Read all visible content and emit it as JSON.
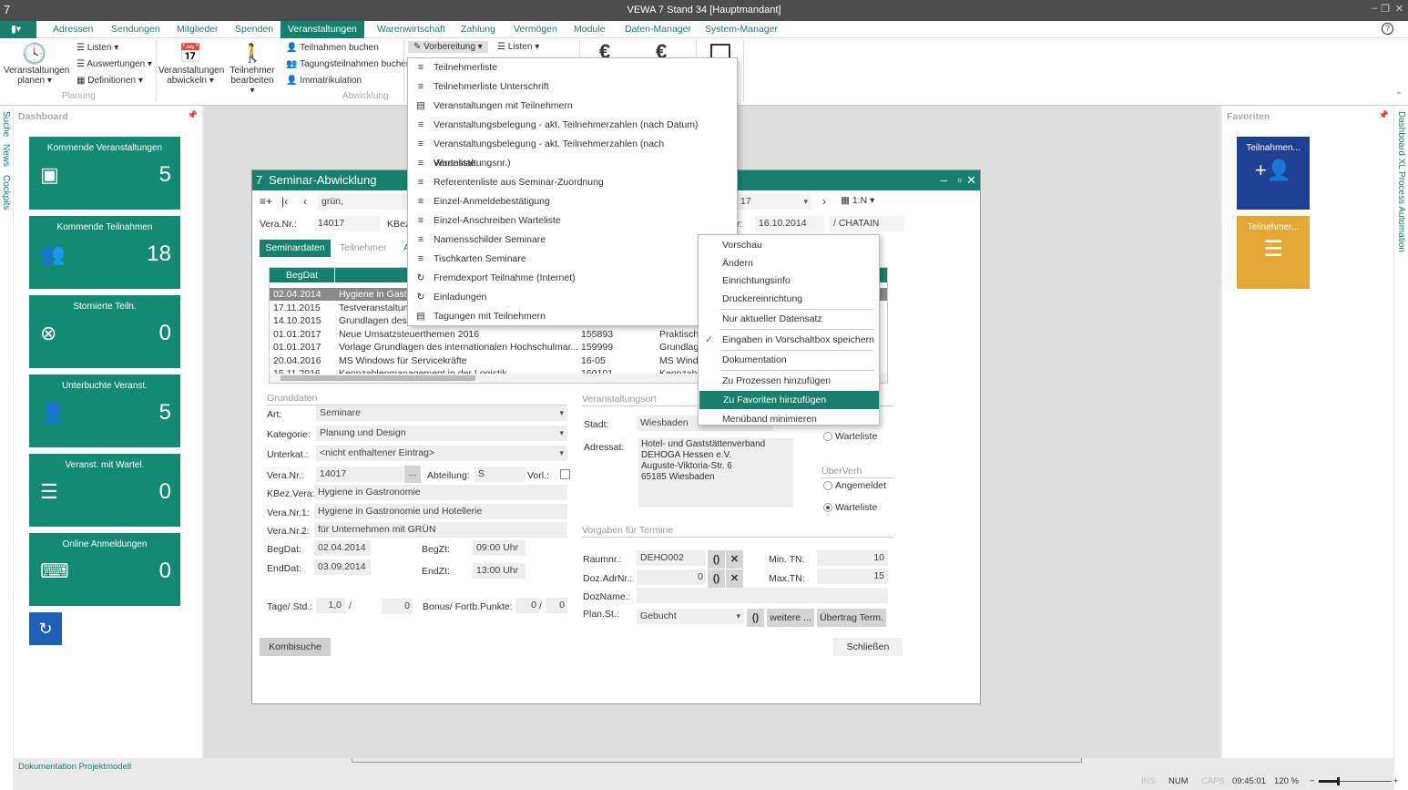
{
  "window": {
    "title": "VEWA 7 Stand 34 [Hauptmandant]",
    "logo": "7"
  },
  "menu": {
    "tabs": [
      "Adressen",
      "Sendungen",
      "Mitglieder",
      "Spenden",
      "Veranstaltungen",
      "Warenwirtschaft",
      "Zahlung",
      "Vermögen",
      "Module",
      "Daten-Manager",
      "System-Manager"
    ],
    "active": "Veranstaltungen"
  },
  "ribbon": {
    "planen": "Veranstaltungen planen ▾",
    "listen": "Listen ▾",
    "auswertungen": "Auswertungen ▾",
    "definitionen": "Definitionen ▾",
    "group_planung": "Planung",
    "abwickeln": "Veranstaltungen abwickeln ▾",
    "bearbeiten": "Teilnehmer bearbeiten ▾",
    "teilnahmen_buchen": "Teilnahmen buchen",
    "tagung_buchen": "Tagungsteilnahmen buchen",
    "immatrikulation": "Immatrikulation",
    "group_abwicklung": "Abwicklung",
    "vorbereitung": "Vorbereitung ▾",
    "listen2": "Listen ▾",
    "euro": "€"
  },
  "dashboard": {
    "title": "Dashboard",
    "tiles": [
      {
        "label": "Kommende Veranstaltungen",
        "value": "5",
        "icon": "calendar-icon"
      },
      {
        "label": "Kommende Teilnahmen",
        "value": "18",
        "icon": "people-icon"
      },
      {
        "label": "Stornierte Teiln.",
        "value": "0",
        "icon": "cancel-circle-icon"
      },
      {
        "label": "Unterbuchte Veranst.",
        "value": "5",
        "icon": "person-icon"
      },
      {
        "label": "Veranst. mit Wartel.",
        "value": "0",
        "icon": "list-icon"
      },
      {
        "label": "Online Anmeldungen",
        "value": "0",
        "icon": "keyboard-icon"
      }
    ],
    "side_tabs": [
      "Suche",
      "News",
      "Cockpits"
    ],
    "footer_link": "Dokumentation Projektmodell"
  },
  "favorites": {
    "title": "Favoriten",
    "tiles": [
      {
        "label": "Teilnahmen...",
        "color": "#1f3f93"
      },
      {
        "label": "Teilnehmer...",
        "color": "#e3a934"
      }
    ],
    "side_tabs": [
      "Dashboard XL",
      "Process Automation"
    ]
  },
  "dropdown": {
    "items": [
      {
        "label": "Teilnehmerliste",
        "icon": "≡"
      },
      {
        "label": "Teilnehmerliste Unterschrift",
        "icon": "≡"
      },
      {
        "label": "Veranstaltungen mit Teilnehmern",
        "icon": "▤"
      },
      {
        "label": "Veranstaltungsbelegung - akt. Teilnehmerzahlen (nach Datum)",
        "icon": "≡"
      },
      {
        "label": "Veranstaltungsbelegung - akt. Teilnehmerzahlen (nach Veranstaltungsnr.)",
        "icon": "≡"
      },
      {
        "label": "Warteliste",
        "icon": "≡"
      },
      {
        "label": "Referentenliste aus Seminar-Zuordnung",
        "icon": "≡"
      },
      {
        "label": "Einzel-Anmeldebestätigung",
        "icon": "≡"
      },
      {
        "label": "Einzel-Anschreiben Warteliste",
        "icon": "≡"
      },
      {
        "label": "Namensschilder Seminare",
        "icon": "≡"
      },
      {
        "label": "Tischkarten Seminare",
        "icon": "≡"
      },
      {
        "label": "Fremdexport Teilnahme (Internet)",
        "icon": "↻"
      },
      {
        "label": "Einladungen",
        "icon": "↻"
      },
      {
        "label": "Tagungen mit Teilnehmern",
        "icon": "▤"
      }
    ]
  },
  "context_menu": {
    "items": [
      {
        "label": "Vorschau"
      },
      {
        "label": "Ändern"
      },
      {
        "label": "Einrichtungsinfo"
      },
      {
        "label": "Druckereinrichtung",
        "sep": true
      },
      {
        "label": "Nur aktueller Datensatz",
        "sep": true
      },
      {
        "label": "Eingaben in Vorschaltbox speichern",
        "checked": true,
        "sep": true
      },
      {
        "label": "Dokumentation",
        "sep": true
      },
      {
        "label": "Zu Prozessen hinzufügen"
      },
      {
        "label": "Zu Favoriten hinzufügen",
        "highlight": true
      },
      {
        "label": "Menüband minimieren"
      }
    ]
  },
  "dialog": {
    "title": "Seminar-Abwicklung",
    "search": "grün,",
    "nav_combo": "17",
    "view_mode": "1:N ▾",
    "vera_nr_label": "Vera.Nr.:",
    "vera_nr": "14017",
    "kbez_label": "KBez",
    "date_label": "er:",
    "date": "16.10.2014",
    "user": "/ CHATAIN",
    "tabs": [
      "Seminardaten",
      "Teilnehmer",
      "A"
    ],
    "grid": {
      "header": "BegDat",
      "rows": [
        [
          "02.04.2014",
          "Hygiene in Gastro",
          "",
          ""
        ],
        [
          "17.11.2015",
          "Testveranstaltung",
          "",
          ""
        ],
        [
          "14.10.2015",
          "Grundlagen des i",
          "",
          ""
        ],
        [
          "01.01.2017",
          "Neue Umsatzsteuerthemen 2016",
          "155893",
          "Praktisch"
        ],
        [
          "01.01.2017",
          "Vorlage Grundlagen des internationalen Hochschulmar...",
          "159999",
          "Grundlage"
        ],
        [
          "20.04.2016",
          "MS Windows für Servicekräfte",
          "16-05",
          "MS Windo"
        ],
        [
          "15.11.2016",
          "Kennzahlenmanagement in der Logistik",
          "160101",
          "Kennzahle"
        ]
      ]
    },
    "grunddaten": {
      "title": "Grunddaten",
      "art_label": "Art:",
      "art": "Seminare",
      "kategorie_label": "Kategorie:",
      "kategorie": "Planung und Design",
      "unterkat_label": "Unterkat.:",
      "unterkat": "<nicht enthaltener Eintrag>",
      "veranr_label": "Vera.Nr.:",
      "veranr": "14017",
      "ellipsis": "...",
      "abteilung_label": "Abteilung:",
      "abteilung": "S",
      "vorl_label": "Vorl.:",
      "kbez_label": "KBez.Vera:",
      "kbez": "Hygiene in Gastronomie",
      "nr1_label": "Vera.Nr.1:",
      "nr1": "Hygiene in Gastronomie und Hotellerie",
      "nr2_label": "Vera.Nr.2:",
      "nr2": "für Unternehmen mit GRÜN",
      "begdat_label": "BegDat:",
      "begdat": "02.04.2014",
      "begzt_label": "BegZt:",
      "begzt": "09:00 Uhr",
      "enddat_label": "EndDat:",
      "enddat": "03.09.2014",
      "endzt_label": "EndZt:",
      "endzt": "13:00 Uhr",
      "tage_label": "Tage/ Std.:",
      "tage": "1,0",
      "slash": "/",
      "std": "0",
      "bonus_label": "Bonus/ Fortb.Punkte:",
      "bonus1": "0",
      "bonus2": "0"
    },
    "ort": {
      "title": "Veranstaltungsort",
      "stadt_label": "Stadt:",
      "stadt": "Wiesbaden",
      "adressat_label": "Adressat:",
      "adressat": [
        "Hotel- und Gaststättenverband",
        "DEHOGA Hessen e.V.",
        "Auguste-Viktoria-Str. 6",
        "65185 Wiesbaden"
      ],
      "warteliste1": "Warteliste",
      "ueberverh": "ÜberVerh",
      "angemeldet": "Angemeldet",
      "warteliste2": "Warteliste"
    },
    "termine": {
      "title": "Vorgaben für Termine",
      "raumnr_label": "Raumnr.:",
      "raumnr": "DEHO002",
      "doz_label": "Doz.AdrNr.:",
      "doz": "0",
      "dozname_label": "DozName.:",
      "planst_label": "Plan.St.:",
      "planst": "Gebucht",
      "min_label": "Min. TN:",
      "min": "10",
      "max_label": "Max.TN:",
      "max": "15",
      "weitere": "weitere ...",
      "uebertrag": "Übertrag Term."
    },
    "kombisuche": "Kombisuche",
    "schliessen": "Schließen"
  },
  "statusbar": {
    "ins": "INS",
    "num": "NUM",
    "caps": "CAPS",
    "time": "09:45:01",
    "zoom": "120 %",
    "zoom_minus": "−",
    "zoom_plus": "+",
    "zoom_level": 0.25
  },
  "colors": {
    "accent": "#17806d",
    "tile": "#138a72"
  }
}
